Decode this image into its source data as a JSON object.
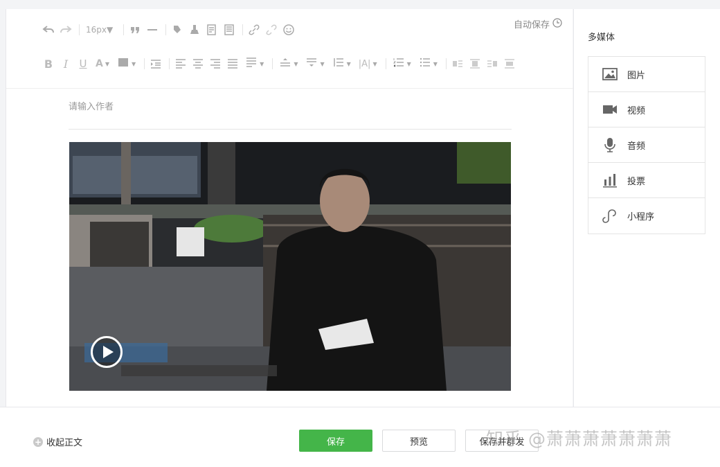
{
  "toolbar": {
    "font_size": "16px"
  },
  "editor": {
    "autosave_label": "自动保存",
    "author_placeholder": "请输入作者"
  },
  "sidebar": {
    "title": "多媒体",
    "items": [
      {
        "label": "图片",
        "icon": "image-icon"
      },
      {
        "label": "视频",
        "icon": "video-camera-icon"
      },
      {
        "label": "音频",
        "icon": "microphone-icon"
      },
      {
        "label": "投票",
        "icon": "bar-chart-icon"
      },
      {
        "label": "小程序",
        "icon": "mini-program-icon"
      }
    ]
  },
  "footer": {
    "collapse_label": "收起正文",
    "save_label": "保存",
    "preview_label": "预览",
    "send_label": "保存并群发",
    "watermark": "知乎 @萧萧萧萧萧萧萧"
  },
  "colors": {
    "primary_green": "#44b549",
    "icon_gray": "#bbbbbb",
    "border": "#e4e4e4"
  }
}
